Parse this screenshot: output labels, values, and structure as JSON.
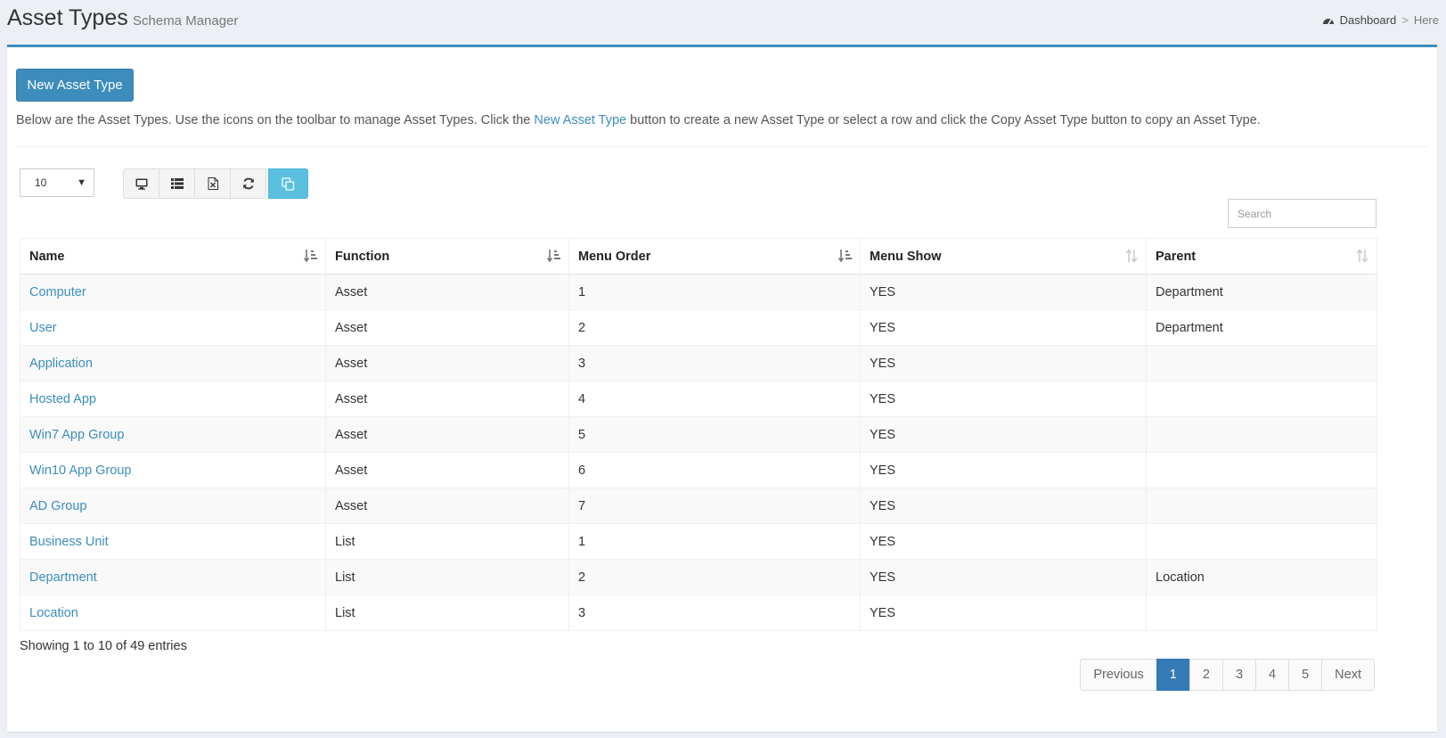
{
  "header": {
    "title": "Asset Types",
    "subtitle": "Schema Manager",
    "breadcrumb": {
      "dashboard": "Dashboard",
      "separator": ">",
      "current": "Here"
    }
  },
  "actions": {
    "new_label": "New Asset Type"
  },
  "intro": {
    "before": "Below are the Asset Types. Use the icons on the toolbar to manage Asset Types. Click the ",
    "link": "New Asset Type",
    "after": " button to create a new Asset Type or select a row and click the Copy Asset Type button to copy an Asset Type."
  },
  "page_length": "10",
  "toolbar": {
    "icons": [
      "desktop-icon",
      "list-icon",
      "excel-icon",
      "refresh-icon",
      "copy-icon"
    ],
    "active_color": "#5bc0de"
  },
  "search": {
    "placeholder": "Search",
    "value": ""
  },
  "table": {
    "columns": [
      "Name",
      "Function",
      "Menu Order",
      "Menu Show",
      "Parent"
    ],
    "rows": [
      [
        "Computer",
        "Asset",
        "1",
        "YES",
        "Department"
      ],
      [
        "User",
        "Asset",
        "2",
        "YES",
        "Department"
      ],
      [
        "Application",
        "Asset",
        "3",
        "YES",
        ""
      ],
      [
        "Hosted App",
        "Asset",
        "4",
        "YES",
        ""
      ],
      [
        "Win7 App Group",
        "Asset",
        "5",
        "YES",
        ""
      ],
      [
        "Win10 App Group",
        "Asset",
        "6",
        "YES",
        ""
      ],
      [
        "AD Group",
        "Asset",
        "7",
        "YES",
        ""
      ],
      [
        "Business Unit",
        "List",
        "1",
        "YES",
        ""
      ],
      [
        "Department",
        "List",
        "2",
        "YES",
        "Location"
      ],
      [
        "Location",
        "List",
        "3",
        "YES",
        ""
      ]
    ]
  },
  "info": "Showing 1 to 10 of 49 entries",
  "pagination": {
    "previous": "Previous",
    "pages": [
      "1",
      "2",
      "3",
      "4",
      "5"
    ],
    "active": "1",
    "next": "Next"
  },
  "colors": {
    "accent": "#3c8dbc",
    "active_page": "#337ab7"
  }
}
